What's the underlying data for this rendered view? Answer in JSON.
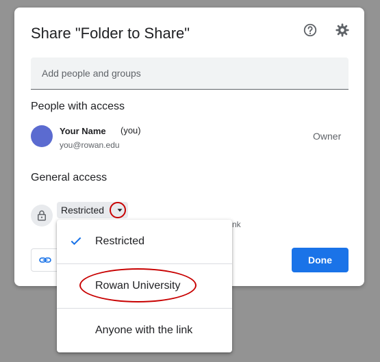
{
  "dialog": {
    "title": "Share \"Folder to Share\"",
    "icons": {
      "help": "help-circle-icon",
      "settings": "gear-icon"
    }
  },
  "add_people": {
    "placeholder": "Add people and groups",
    "value": ""
  },
  "people_with_access": {
    "title": "People with access",
    "users": [
      {
        "name": "Your Name",
        "suffix": "(you)",
        "email": "you@rowan.edu",
        "role": "Owner"
      }
    ]
  },
  "general_access": {
    "title": "General access",
    "selected": "Restricted",
    "description_partial": "nk",
    "icon": "lock-icon"
  },
  "dropdown": {
    "items": [
      {
        "label": "Restricted",
        "checked": true
      },
      {
        "label": "Rowan University",
        "checked": false
      },
      {
        "label": "Anyone with the link",
        "checked": false
      }
    ]
  },
  "footer": {
    "copy_link_icon": "link-icon",
    "done_label": "Done"
  },
  "colors": {
    "backdrop": "#939393",
    "accent": "#1a73e8",
    "avatar": "#5b6bd0",
    "annotation": "#c80000"
  }
}
